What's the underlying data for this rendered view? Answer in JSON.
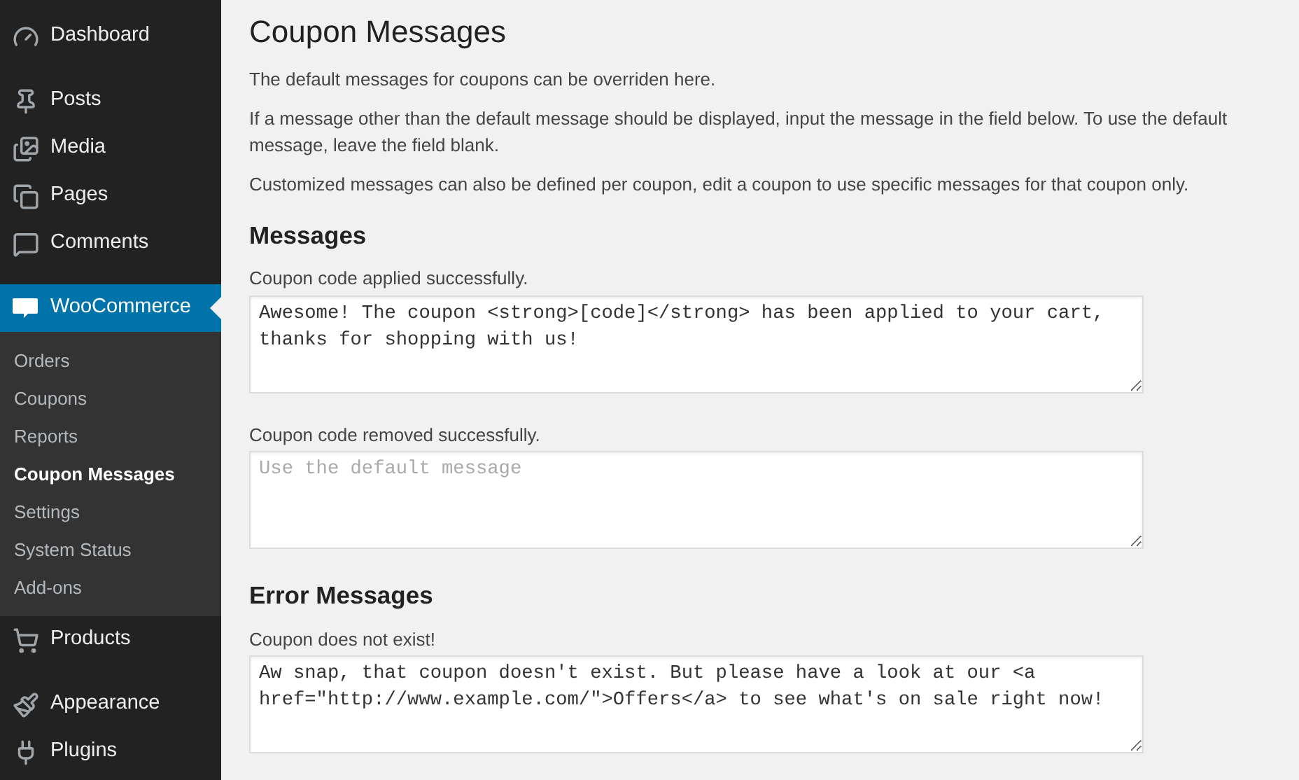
{
  "sidebar": {
    "groups": [
      [
        {
          "label": "Dashboard",
          "kind": "gauge",
          "selected": false
        }
      ],
      [
        {
          "label": "Posts",
          "kind": "pin",
          "selected": false
        },
        {
          "label": "Media",
          "kind": "media",
          "selected": false
        },
        {
          "label": "Pages",
          "kind": "pages",
          "selected": false
        },
        {
          "label": "Comments",
          "kind": "comment",
          "selected": false
        }
      ],
      [
        {
          "label": "WooCommerce",
          "kind": "woo",
          "selected": true,
          "children": [
            {
              "label": "Orders",
              "selected": false
            },
            {
              "label": "Coupons",
              "selected": false
            },
            {
              "label": "Reports",
              "selected": false
            },
            {
              "label": "Coupon Messages",
              "selected": true
            },
            {
              "label": "Settings",
              "selected": false
            },
            {
              "label": "System Status",
              "selected": false
            },
            {
              "label": "Add-ons",
              "selected": false
            }
          ]
        },
        {
          "label": "Products",
          "kind": "cart",
          "selected": false
        }
      ],
      [
        {
          "label": "Appearance",
          "kind": "brush",
          "selected": false
        },
        {
          "label": "Plugins",
          "kind": "plug",
          "selected": false
        }
      ]
    ]
  },
  "page": {
    "title": "Coupon Messages",
    "intro": [
      "The default messages for coupons can be overriden here.",
      "If a message other than the default message should be displayed, input the message in the field below. To use the default message, leave the field blank.",
      "Customized messages can also be defined per coupon, edit a coupon to use specific messages for that coupon only."
    ],
    "sections": [
      {
        "heading": "Messages",
        "fields": [
          {
            "label": "Coupon code applied successfully.",
            "value": "Awesome! The coupon <strong>[code]</strong> has been applied to your cart, thanks for shopping with us!"
          },
          {
            "label": "Coupon code removed successfully.",
            "placeholder": "Use the default message"
          }
        ]
      },
      {
        "heading": "Error Messages",
        "fields": [
          {
            "label": "Coupon does not exist!",
            "value": "Aw snap, that coupon doesn't exist. But please have a look at our <a href=\"http://www.example.com/\">Offers</a> to see what's on sale right now!"
          }
        ]
      }
    ]
  }
}
